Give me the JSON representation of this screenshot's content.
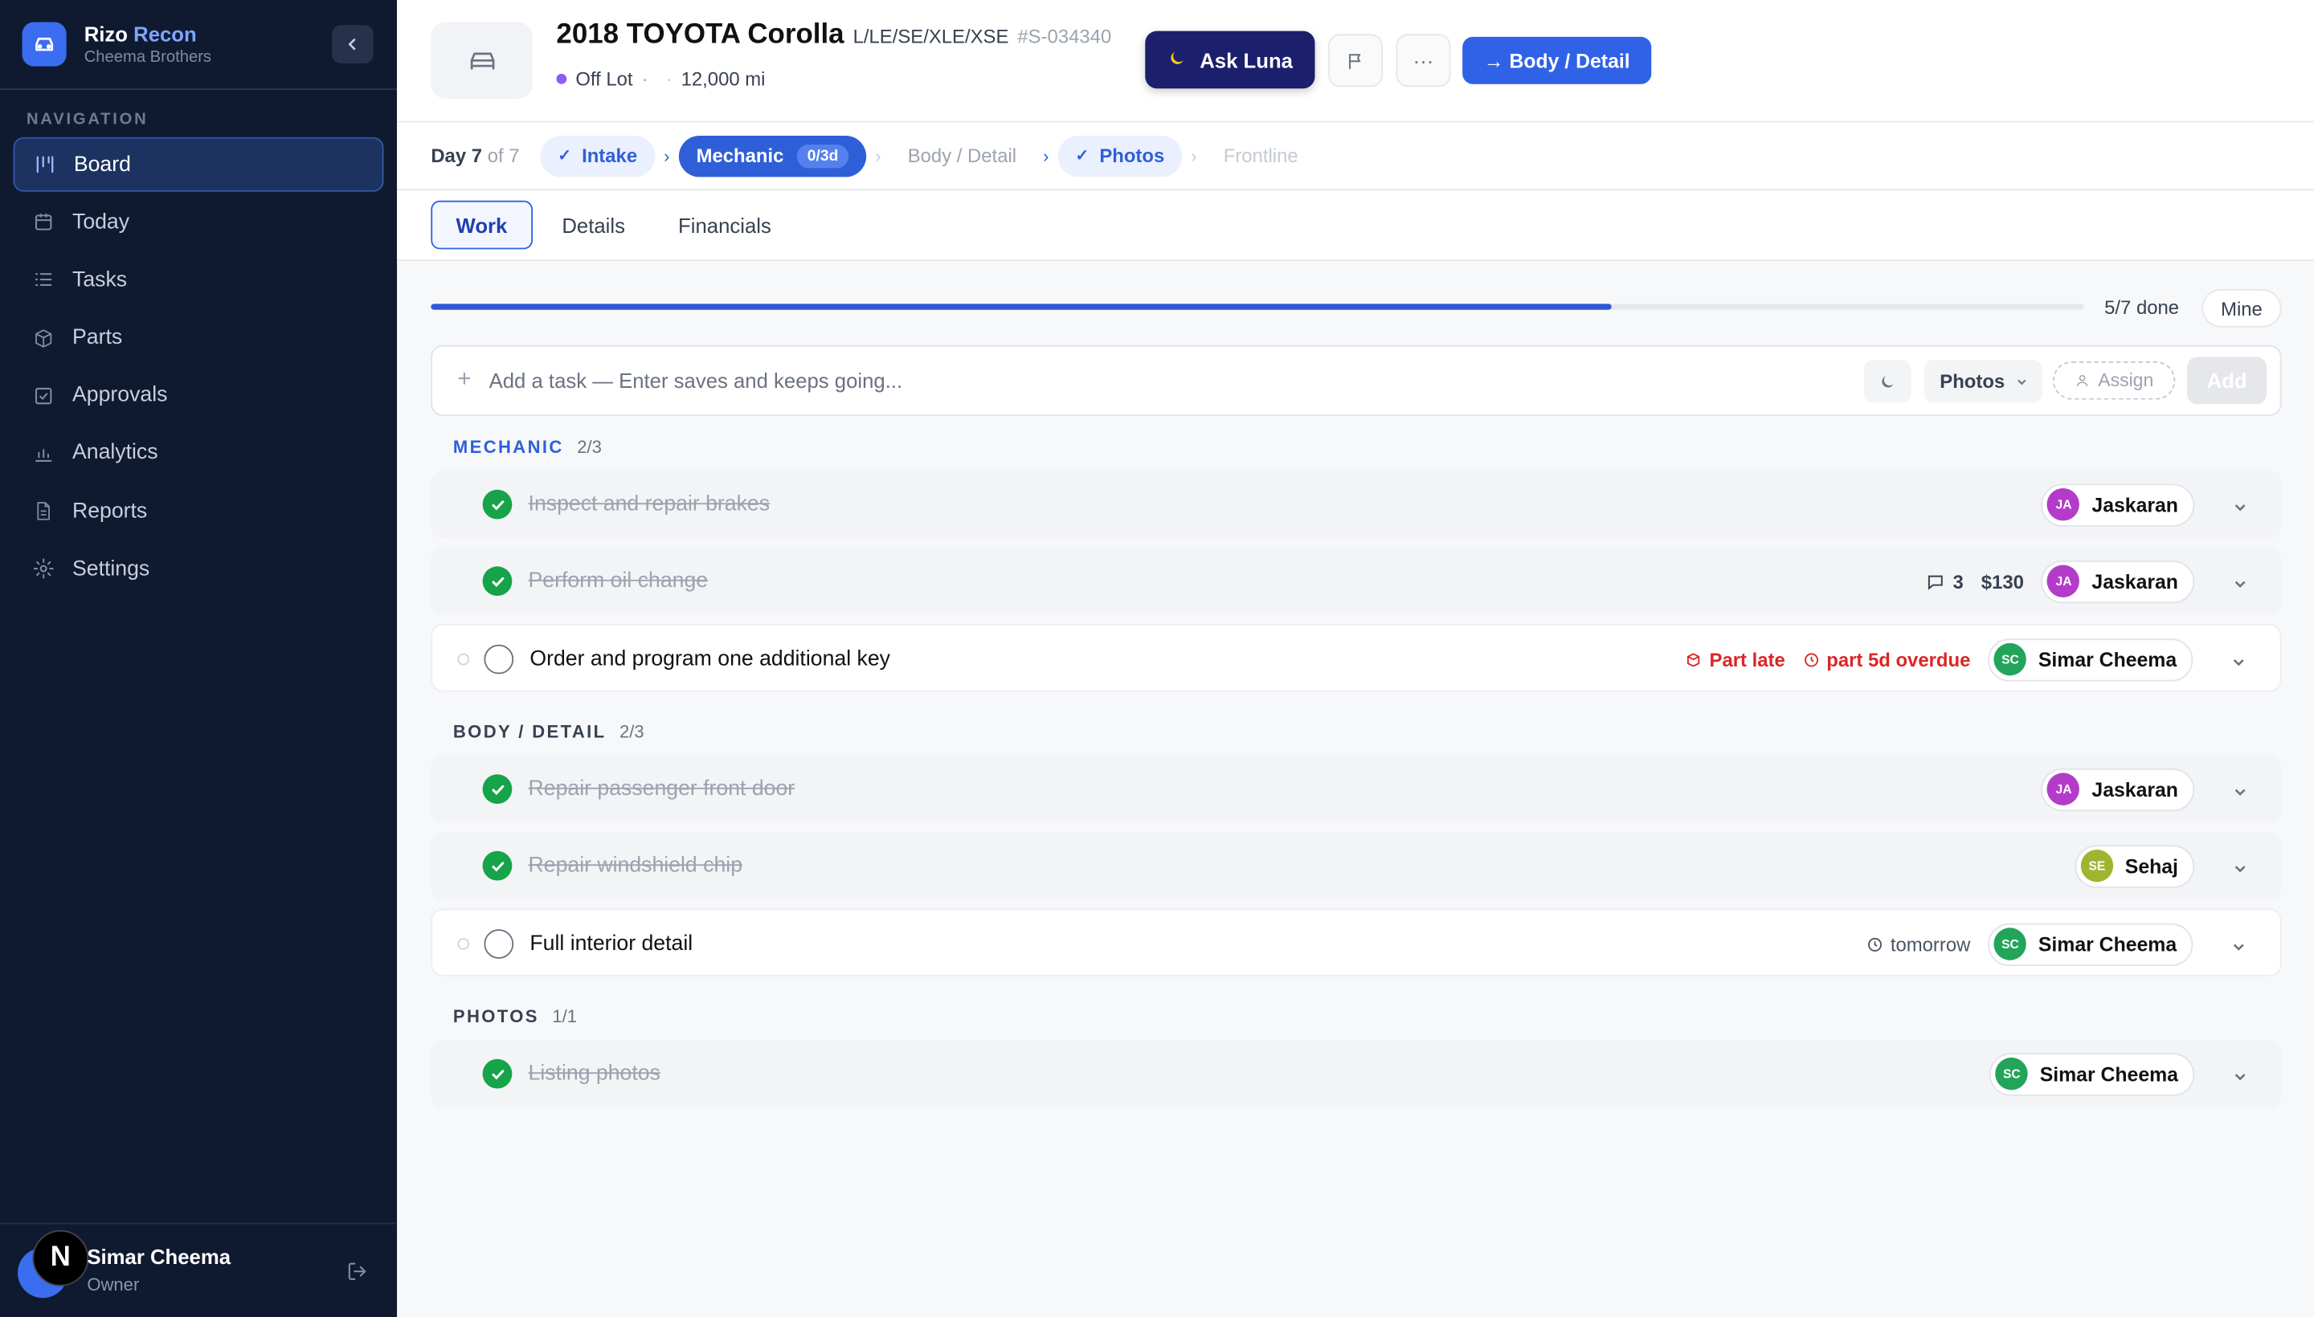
{
  "brand": {
    "name_part1": "Rizo",
    "name_part2": "Recon",
    "subtitle": "Cheema Brothers"
  },
  "sidebar": {
    "section_title": "NAVIGATION",
    "items": [
      {
        "label": "Board",
        "icon": "board-icon",
        "active": true
      },
      {
        "label": "Today",
        "icon": "calendar-icon"
      },
      {
        "label": "Tasks",
        "icon": "list-icon"
      },
      {
        "label": "Parts",
        "icon": "box-icon"
      },
      {
        "label": "Approvals",
        "icon": "checkbox-icon"
      },
      {
        "label": "Analytics",
        "icon": "bar-chart-icon"
      },
      {
        "label": "Reports",
        "icon": "document-icon"
      },
      {
        "label": "Settings",
        "icon": "gear-icon"
      }
    ]
  },
  "user": {
    "name": "Simar Cheema",
    "role": "Owner",
    "badge": "N"
  },
  "vehicle": {
    "title": "2018 TOYOTA Corolla",
    "trim": "L/LE/SE/XLE/XSE",
    "stock": "#S-034340",
    "status": "Off Lot",
    "status_sep": "·",
    "sep": "·",
    "mileage": "12,000 mi"
  },
  "actions": {
    "ask_label": "Ask Luna",
    "more_label": "···",
    "next_label": "→ Body / Detail"
  },
  "stages": {
    "day_label": "Day 7",
    "day_of": "of 7",
    "items": [
      {
        "label": "Intake",
        "state": "done"
      },
      {
        "label": "Mechanic",
        "state": "active",
        "pill": "0/3d"
      },
      {
        "label": "Body / Detail",
        "state": "pending"
      },
      {
        "label": "Photos",
        "state": "done"
      },
      {
        "label": "Frontline",
        "state": "future"
      }
    ]
  },
  "tabs": [
    {
      "label": "Work",
      "active": true
    },
    {
      "label": "Details"
    },
    {
      "label": "Financials"
    }
  ],
  "progress": {
    "done": 5,
    "total": 7,
    "label": "5/7 done",
    "mine_label": "Mine"
  },
  "add_task": {
    "placeholder": "Add a task — Enter saves and keeps going...",
    "stage_value": "Photos",
    "assign_label": "Assign",
    "add_label": "Add"
  },
  "groups": [
    {
      "title": "MECHANIC",
      "count": "2/3",
      "color": "#2f5fd8",
      "tasks": [
        {
          "name": "Inspect and repair brakes",
          "done": true,
          "assignee": "Jaskaran",
          "initials": "JA"
        },
        {
          "name": "Perform oil change",
          "done": true,
          "comments": "3",
          "cost": "$130",
          "assignee": "Jaskaran",
          "initials": "JA"
        },
        {
          "name": "Order and program one additional key",
          "done": false,
          "part_status": "Part late",
          "due": "part 5d overdue",
          "assignee": "Simar Cheema",
          "initials": "SC"
        }
      ]
    },
    {
      "title": "BODY / DETAIL",
      "count": "2/3",
      "color": "#374151",
      "tasks": [
        {
          "name": "Repair passenger front door",
          "done": true,
          "assignee": "Jaskaran",
          "initials": "JA"
        },
        {
          "name": "Repair windshield chip",
          "done": true,
          "assignee": "Sehaj",
          "initials": "SE"
        },
        {
          "name": "Full interior detail",
          "done": false,
          "due": "tomorrow",
          "assignee": "Simar Cheema",
          "initials": "SC"
        }
      ]
    },
    {
      "title": "PHOTOS",
      "count": "1/1",
      "color": "#374151",
      "tasks": [
        {
          "name": "Listing photos",
          "done": true,
          "assignee": "Simar Cheema",
          "initials": "SC"
        }
      ]
    }
  ]
}
